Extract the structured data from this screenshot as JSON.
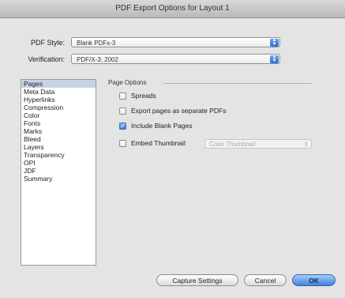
{
  "window": {
    "title": "PDF Export Options for Layout 1"
  },
  "pdf_style": {
    "label": "PDF Style:",
    "value": "Blank PDFx-3"
  },
  "verification": {
    "label": "Verification:",
    "value": "PDF/X-3: 2002"
  },
  "sidebar": {
    "items": [
      {
        "label": "Pages",
        "selected": true
      },
      {
        "label": "Meta Data"
      },
      {
        "label": "Hyperlinks"
      },
      {
        "label": "Compression"
      },
      {
        "label": "Color"
      },
      {
        "label": "Fonts"
      },
      {
        "label": "Marks"
      },
      {
        "label": "Bleed"
      },
      {
        "label": "Layers"
      },
      {
        "label": "Transparency"
      },
      {
        "label": "OPI"
      },
      {
        "label": "JDF"
      },
      {
        "label": "Summary"
      }
    ]
  },
  "page_options": {
    "title": "Page Options",
    "spreads": {
      "label": "Spreads",
      "checked": false
    },
    "separate": {
      "label": "Export pages as separate PDFs",
      "checked": false
    },
    "blank": {
      "label": "Include Blank Pages",
      "checked": true
    },
    "thumbnail": {
      "label": "Embed Thumbnail",
      "checked": false,
      "option": "Color Thumbnail"
    }
  },
  "buttons": {
    "capture": "Capture Settings",
    "cancel": "Cancel",
    "ok": "OK"
  },
  "colors": {
    "accent": "#3c82de",
    "selection": "#c6d3e6"
  }
}
